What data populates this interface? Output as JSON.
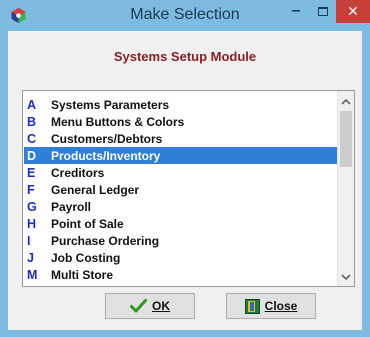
{
  "window": {
    "title": "Make Selection",
    "minimize_glyph": "−",
    "close_glyph": "✕"
  },
  "module": {
    "heading": "Systems Setup Module"
  },
  "list": {
    "selected_index": 3,
    "items": [
      {
        "key": "A",
        "label": "Systems Parameters"
      },
      {
        "key": "B",
        "label": "Menu Buttons & Colors"
      },
      {
        "key": "C",
        "label": "Customers/Debtors"
      },
      {
        "key": "D",
        "label": "Products/Inventory"
      },
      {
        "key": "E",
        "label": "Creditors"
      },
      {
        "key": "F",
        "label": "General Ledger"
      },
      {
        "key": "G",
        "label": "Payroll"
      },
      {
        "key": "H",
        "label": "Point of Sale"
      },
      {
        "key": "I",
        "label": "Purchase Ordering"
      },
      {
        "key": "J",
        "label": "Job Costing"
      },
      {
        "key": "M",
        "label": "Multi Store"
      }
    ]
  },
  "buttons": {
    "ok_label": "OK",
    "close_label": "Close"
  },
  "icons": {
    "app": "app-icon",
    "ok": "checkmark-icon",
    "close": "exit-door-icon",
    "scroll_up": "chevron-up-icon",
    "scroll_down": "chevron-down-icon"
  },
  "colors": {
    "titlebar": "#7ebbe0",
    "close_button": "#c7403a",
    "heading": "#8b1f1f",
    "key_letter": "#1a2bd8",
    "selection": "#2f7fd6",
    "ok_check": "#2e9a1e"
  }
}
